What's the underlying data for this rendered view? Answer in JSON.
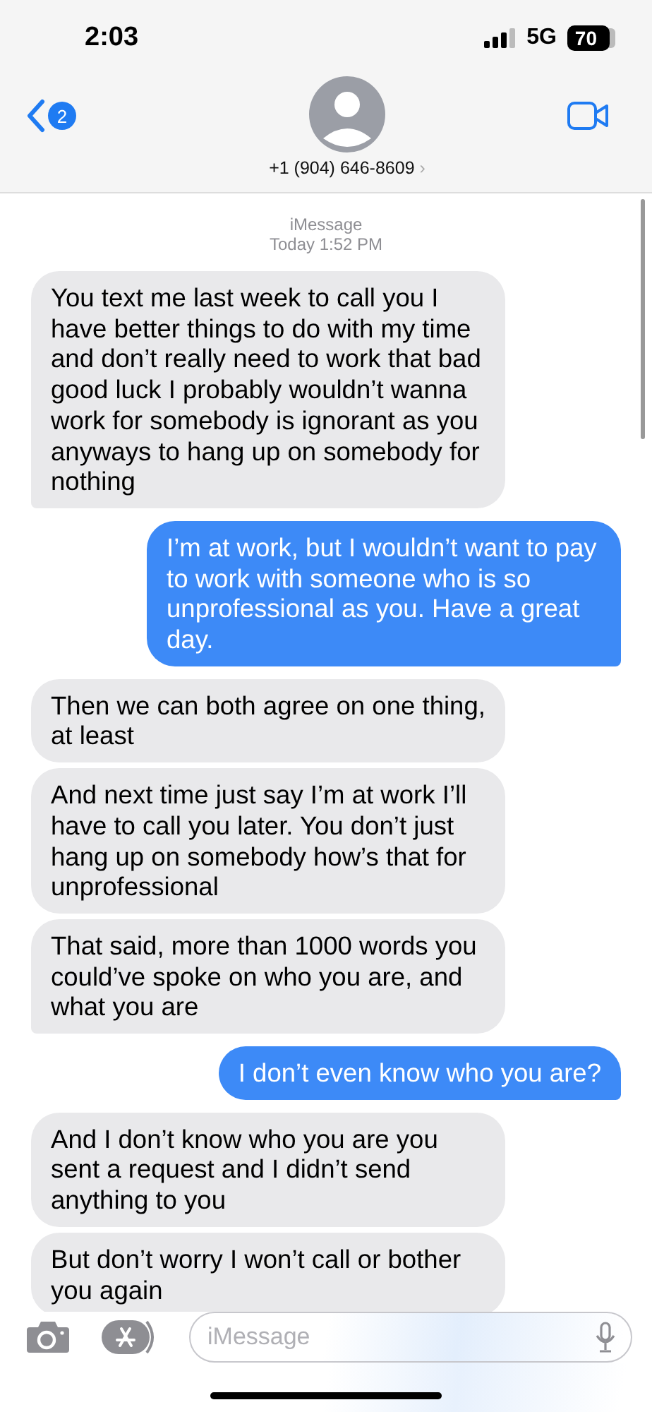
{
  "status_bar": {
    "time": "2:03",
    "network": "5G",
    "battery": "70"
  },
  "header": {
    "back_badge": "2",
    "contact": "+1 (904) 646-8609",
    "chevron": "›"
  },
  "conversation": {
    "service": "iMessage",
    "timestamp": "Today 1:52 PM"
  },
  "messages": [
    {
      "kind": "incoming",
      "tail": true,
      "text": "You text me last week to call you I have better things to do with my time and don’t really need to work that bad good luck I probably wouldn’t wanna work for somebody is ignorant as you anyways to hang up on somebody for nothing"
    },
    {
      "kind": "outgoing",
      "tail": true,
      "text": "I’m at work, but I wouldn’t want to pay to work with someone who is so unprofessional as you. Have a great day."
    },
    {
      "kind": "incoming",
      "tail": false,
      "text": "Then we can both agree on one thing, at least"
    },
    {
      "kind": "incoming",
      "tail": false,
      "text": "And next time just say I’m at work I’ll have to call you later. You don’t just hang up on somebody how’s that for unprofessional"
    },
    {
      "kind": "incoming",
      "tail": true,
      "text": "That said, more than 1000 words you could’ve spoke on who you are, and what you are"
    },
    {
      "kind": "outgoing",
      "tail": true,
      "text": "I don’t even know who you are?"
    },
    {
      "kind": "incoming",
      "tail": false,
      "text": "And I don’t know who you are you sent a request and I didn’t send anything to you"
    },
    {
      "kind": "incoming",
      "tail": false,
      "text": "But don’t worry I won’t call or bother you again"
    }
  ],
  "composer": {
    "placeholder": "iMessage"
  }
}
